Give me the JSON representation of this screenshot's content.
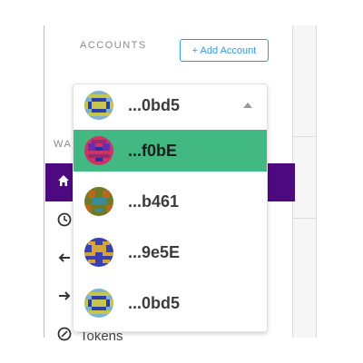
{
  "accounts_section": {
    "label": "ACCOUNTS",
    "add_account_label": "+ Add Account"
  },
  "selected_account": {
    "address": "...0bd5"
  },
  "dropdown": {
    "items": [
      {
        "address": "...f0bE",
        "selected": true
      },
      {
        "address": "...b461",
        "selected": false
      },
      {
        "address": "...9e5E",
        "selected": false
      },
      {
        "address": "...0bd5",
        "selected": false
      }
    ]
  },
  "wallet_nav": {
    "section_label": "WA",
    "tokens_label": "Tokens"
  },
  "colors": {
    "accent": "#2f9ae0",
    "selected_row": "#42b883",
    "nav_active": "#4d0a80"
  },
  "icons": [
    "home-icon",
    "clock-icon",
    "arrow-left-icon",
    "arrow-right-icon",
    "tokens-icon",
    "caret-up-icon"
  ]
}
